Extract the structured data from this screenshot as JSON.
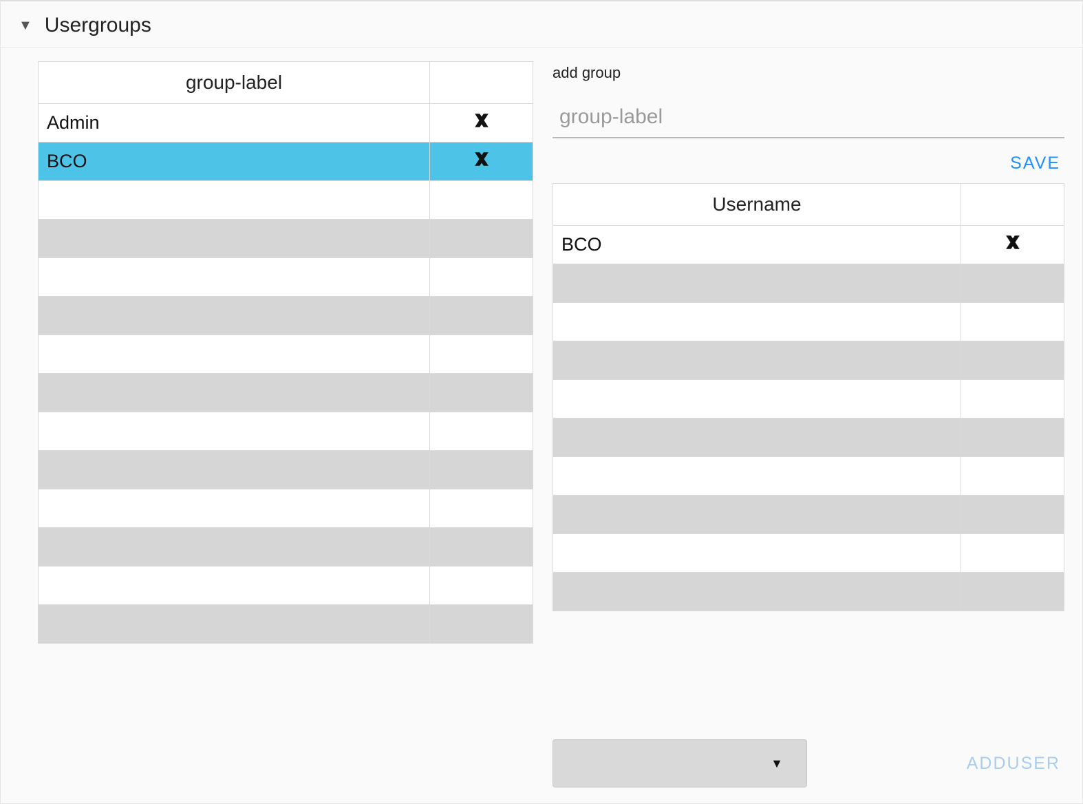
{
  "panel": {
    "title": "Usergroups"
  },
  "groups_table": {
    "header": "group-label",
    "rows": [
      {
        "label": "Admin",
        "selected": false,
        "has_delete": true
      },
      {
        "label": "BCO",
        "selected": true,
        "has_delete": true
      }
    ],
    "empty_rows": 12
  },
  "add_group": {
    "label": "add group",
    "placeholder": "group-label",
    "value": "",
    "save_label": "SAVE"
  },
  "users_table": {
    "header": "Username",
    "rows": [
      {
        "label": "BCO",
        "has_delete": true
      }
    ],
    "empty_rows": 9
  },
  "add_user": {
    "selected": "",
    "button_label": "ADDUSER",
    "enabled": false
  }
}
